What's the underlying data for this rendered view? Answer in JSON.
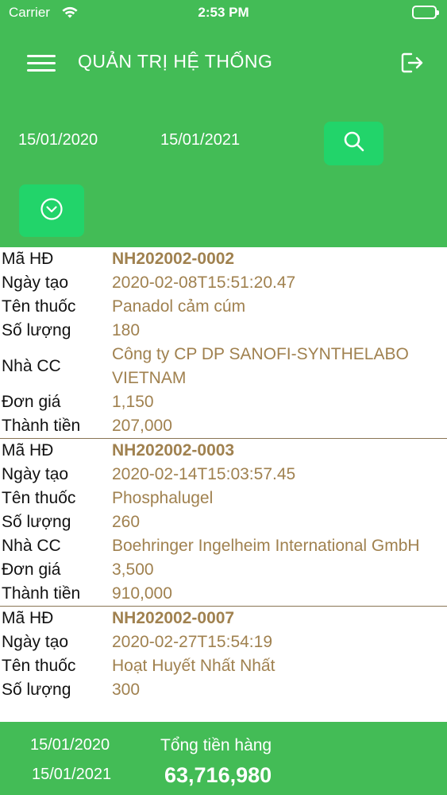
{
  "status_bar": {
    "carrier": "Carrier",
    "time": "2:53 PM"
  },
  "header": {
    "title": "QUẢN TRỊ HỆ THỐNG",
    "date_from": "15/01/2020",
    "date_to": "15/01/2021"
  },
  "labels": {
    "code": "Mã HĐ",
    "created": "Ngày tạo",
    "drug": "Tên thuốc",
    "qty": "Số lượng",
    "supplier": "Nhà CC",
    "price": "Đơn giá",
    "total": "Thành tiền"
  },
  "records": [
    {
      "code": "NH202002-0002",
      "created": "2020-02-08T15:51:20.47",
      "drug": "Panadol cảm cúm",
      "qty": "180",
      "supplier": "Công ty CP DP SANOFI-SYNTHELABO VIETNAM",
      "price": "1,150",
      "total": "207,000"
    },
    {
      "code": "NH202002-0003",
      "created": "2020-02-14T15:03:57.45",
      "drug": "Phosphalugel",
      "qty": "260",
      "supplier": "Boehringer Ingelheim International GmbH",
      "price": "3,500",
      "total": "910,000"
    },
    {
      "code": "NH202002-0007",
      "created": "2020-02-27T15:54:19",
      "drug": "Hoạt Huyết Nhất Nhất",
      "qty": "300"
    }
  ],
  "footer": {
    "date_from": "15/01/2020",
    "date_to": "15/01/2021",
    "total_label": "Tổng tiền hàng",
    "total_value": "63,716,980"
  },
  "colors": {
    "primary": "#43bc56",
    "button": "#22d46a",
    "value_text": "#a0814f"
  },
  "icons": [
    "wifi-icon",
    "battery-icon",
    "menu-icon",
    "logout-icon",
    "search-icon",
    "chevron-down-circle-icon"
  ]
}
